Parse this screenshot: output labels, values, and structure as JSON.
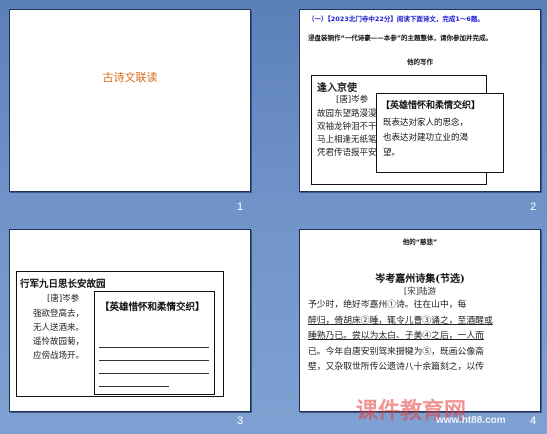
{
  "slides": [
    {
      "number": "1",
      "title": "古诗文联读"
    },
    {
      "number": "2",
      "header_line1": "（一）【2023北门寺中22分】阅读下面诗文，完成1～6题。",
      "header_line2": "浸盘装铜作“一代诗豪——本参”的主题整体，请你参加并完成。",
      "caption": "他的写作",
      "poem_title": "逢入京使",
      "poem_author": "[唐]岑参",
      "poem_lines": [
        "故园东望路漫漫，",
        "双袖龙钟泪不干。",
        "马上相逢无纸笔，",
        "凭君传语报平安。"
      ],
      "overlay_title": "【英雄惜怀和柔情交织】",
      "overlay_lines": [
        "既表达对家人的思念，",
        "也表达对建功立业的渴",
        "望。"
      ]
    },
    {
      "number": "3",
      "poem_title": "行军九日思长安故园",
      "poem_author": "[唐]岑参",
      "poem_lines": [
        "强欲登高去，",
        "无人送酒来。",
        "遥怜故园菊，",
        "应傍战场开。"
      ],
      "overlay_title": "【英雄惜怀和柔情交织】"
    },
    {
      "number": "4",
      "caption": "他的“慈悲”",
      "title": "岑考嘉州诗集(节选)",
      "author": "[宋]陆游",
      "body_lines": [
        "予少时，绝好岑嘉州①诗。往在山中，每",
        "醉归，倚胡床②睡，辄令儿曹③诵之，至酒醒或",
        "睡熟乃已。尝以为太白、子美④之后，一人而",
        "已。今年自唐安别驾来摄犍为⑤，既画公像斋",
        "壁，又杂取世所传公遗诗八十余篇刻之，以传"
      ]
    }
  ],
  "watermark": {
    "logo": "课件教育网",
    "url": "www.ht88.com"
  }
}
